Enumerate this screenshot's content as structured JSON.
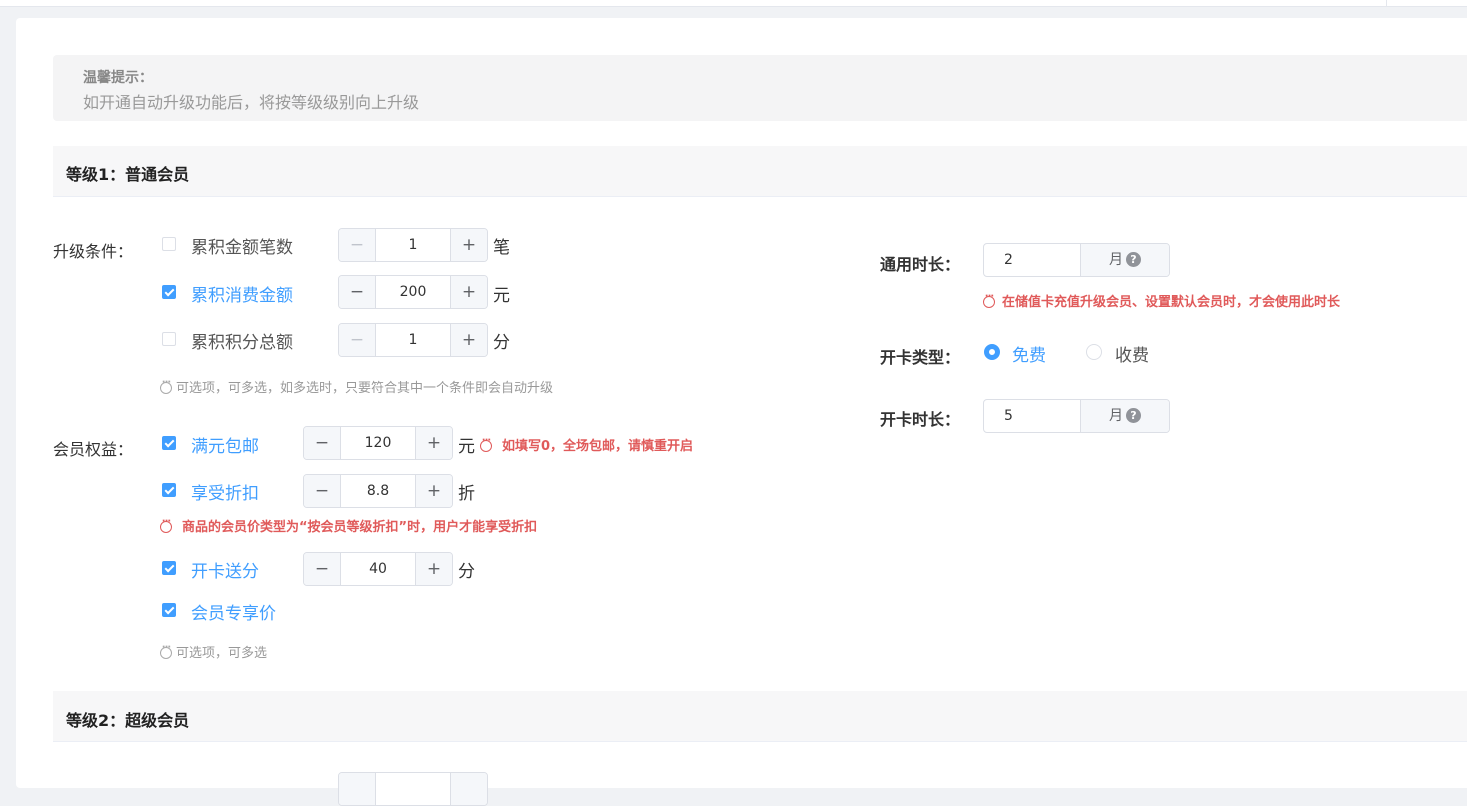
{
  "tip": {
    "title": "温馨提示：",
    "text": "如开通自动升级功能后，将按等级级别向上升级"
  },
  "levels": [
    {
      "title": "等级1：普通会员"
    },
    {
      "title": "等级2：超级会员"
    }
  ],
  "upgrade": {
    "label": "升级条件：",
    "conditions": [
      {
        "label": "累积金额笔数",
        "checked": false,
        "value": "1",
        "unit": "笔"
      },
      {
        "label": "累积消费金额",
        "checked": true,
        "value": "200",
        "unit": "元"
      },
      {
        "label": "累积积分总额",
        "checked": false,
        "value": "1",
        "unit": "分"
      }
    ],
    "hint": "可选项，可多选，如多选时，只要符合其中一个条件即会自动升级"
  },
  "benefits": {
    "label": "会员权益：",
    "items": [
      {
        "label": "满元包邮",
        "checked": true,
        "value": "120",
        "unit": "元",
        "warning": "如填写0，全场包邮，请慎重开启"
      },
      {
        "label": "享受折扣",
        "checked": true,
        "value": "8.8",
        "unit": "折",
        "warning": "商品的会员价类型为“按会员等级折扣”时，用户才能享受折扣"
      },
      {
        "label": "开卡送分",
        "checked": true,
        "value": "40",
        "unit": "分"
      },
      {
        "label": "会员专享价",
        "checked": true
      }
    ],
    "hint": "可选项，可多选"
  },
  "validity": {
    "label": "通用时长：",
    "value": "2",
    "unit": "月",
    "warning": "在储值卡充值升级会员、设置默认会员时，才会使用此时长"
  },
  "card_type": {
    "label": "开卡类型：",
    "options": [
      {
        "label": "免费",
        "selected": true
      },
      {
        "label": "收费",
        "selected": false
      }
    ]
  },
  "card_duration": {
    "label": "开卡时长：",
    "value": "5",
    "unit": "月"
  },
  "colors": {
    "accent": "#409eff",
    "warning": "#e05a5a",
    "hint": "#999999"
  }
}
